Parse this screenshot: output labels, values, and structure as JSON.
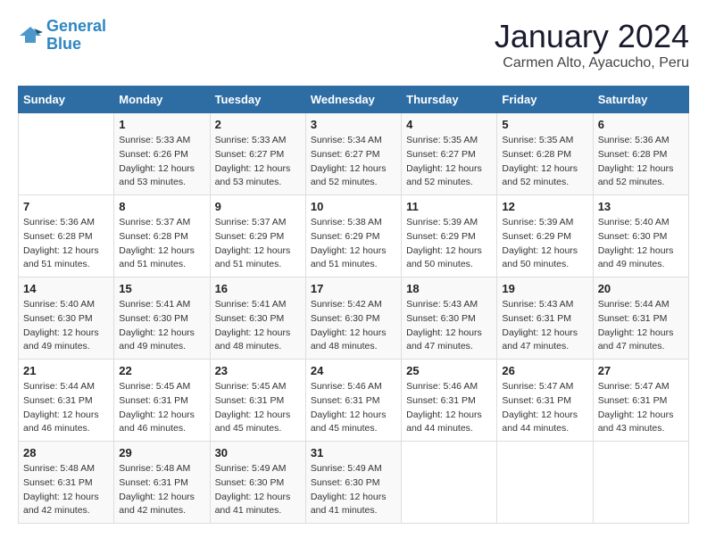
{
  "header": {
    "logo_line1": "General",
    "logo_line2": "Blue",
    "month": "January 2024",
    "location": "Carmen Alto, Ayacucho, Peru"
  },
  "days_of_week": [
    "Sunday",
    "Monday",
    "Tuesday",
    "Wednesday",
    "Thursday",
    "Friday",
    "Saturday"
  ],
  "weeks": [
    [
      {
        "day": "",
        "sunrise": "",
        "sunset": "",
        "daylight": ""
      },
      {
        "day": "1",
        "sunrise": "Sunrise: 5:33 AM",
        "sunset": "Sunset: 6:26 PM",
        "daylight": "Daylight: 12 hours and 53 minutes."
      },
      {
        "day": "2",
        "sunrise": "Sunrise: 5:33 AM",
        "sunset": "Sunset: 6:27 PM",
        "daylight": "Daylight: 12 hours and 53 minutes."
      },
      {
        "day": "3",
        "sunrise": "Sunrise: 5:34 AM",
        "sunset": "Sunset: 6:27 PM",
        "daylight": "Daylight: 12 hours and 52 minutes."
      },
      {
        "day": "4",
        "sunrise": "Sunrise: 5:35 AM",
        "sunset": "Sunset: 6:27 PM",
        "daylight": "Daylight: 12 hours and 52 minutes."
      },
      {
        "day": "5",
        "sunrise": "Sunrise: 5:35 AM",
        "sunset": "Sunset: 6:28 PM",
        "daylight": "Daylight: 12 hours and 52 minutes."
      },
      {
        "day": "6",
        "sunrise": "Sunrise: 5:36 AM",
        "sunset": "Sunset: 6:28 PM",
        "daylight": "Daylight: 12 hours and 52 minutes."
      }
    ],
    [
      {
        "day": "7",
        "sunrise": "Sunrise: 5:36 AM",
        "sunset": "Sunset: 6:28 PM",
        "daylight": "Daylight: 12 hours and 51 minutes."
      },
      {
        "day": "8",
        "sunrise": "Sunrise: 5:37 AM",
        "sunset": "Sunset: 6:28 PM",
        "daylight": "Daylight: 12 hours and 51 minutes."
      },
      {
        "day": "9",
        "sunrise": "Sunrise: 5:37 AM",
        "sunset": "Sunset: 6:29 PM",
        "daylight": "Daylight: 12 hours and 51 minutes."
      },
      {
        "day": "10",
        "sunrise": "Sunrise: 5:38 AM",
        "sunset": "Sunset: 6:29 PM",
        "daylight": "Daylight: 12 hours and 51 minutes."
      },
      {
        "day": "11",
        "sunrise": "Sunrise: 5:39 AM",
        "sunset": "Sunset: 6:29 PM",
        "daylight": "Daylight: 12 hours and 50 minutes."
      },
      {
        "day": "12",
        "sunrise": "Sunrise: 5:39 AM",
        "sunset": "Sunset: 6:29 PM",
        "daylight": "Daylight: 12 hours and 50 minutes."
      },
      {
        "day": "13",
        "sunrise": "Sunrise: 5:40 AM",
        "sunset": "Sunset: 6:30 PM",
        "daylight": "Daylight: 12 hours and 49 minutes."
      }
    ],
    [
      {
        "day": "14",
        "sunrise": "Sunrise: 5:40 AM",
        "sunset": "Sunset: 6:30 PM",
        "daylight": "Daylight: 12 hours and 49 minutes."
      },
      {
        "day": "15",
        "sunrise": "Sunrise: 5:41 AM",
        "sunset": "Sunset: 6:30 PM",
        "daylight": "Daylight: 12 hours and 49 minutes."
      },
      {
        "day": "16",
        "sunrise": "Sunrise: 5:41 AM",
        "sunset": "Sunset: 6:30 PM",
        "daylight": "Daylight: 12 hours and 48 minutes."
      },
      {
        "day": "17",
        "sunrise": "Sunrise: 5:42 AM",
        "sunset": "Sunset: 6:30 PM",
        "daylight": "Daylight: 12 hours and 48 minutes."
      },
      {
        "day": "18",
        "sunrise": "Sunrise: 5:43 AM",
        "sunset": "Sunset: 6:30 PM",
        "daylight": "Daylight: 12 hours and 47 minutes."
      },
      {
        "day": "19",
        "sunrise": "Sunrise: 5:43 AM",
        "sunset": "Sunset: 6:31 PM",
        "daylight": "Daylight: 12 hours and 47 minutes."
      },
      {
        "day": "20",
        "sunrise": "Sunrise: 5:44 AM",
        "sunset": "Sunset: 6:31 PM",
        "daylight": "Daylight: 12 hours and 47 minutes."
      }
    ],
    [
      {
        "day": "21",
        "sunrise": "Sunrise: 5:44 AM",
        "sunset": "Sunset: 6:31 PM",
        "daylight": "Daylight: 12 hours and 46 minutes."
      },
      {
        "day": "22",
        "sunrise": "Sunrise: 5:45 AM",
        "sunset": "Sunset: 6:31 PM",
        "daylight": "Daylight: 12 hours and 46 minutes."
      },
      {
        "day": "23",
        "sunrise": "Sunrise: 5:45 AM",
        "sunset": "Sunset: 6:31 PM",
        "daylight": "Daylight: 12 hours and 45 minutes."
      },
      {
        "day": "24",
        "sunrise": "Sunrise: 5:46 AM",
        "sunset": "Sunset: 6:31 PM",
        "daylight": "Daylight: 12 hours and 45 minutes."
      },
      {
        "day": "25",
        "sunrise": "Sunrise: 5:46 AM",
        "sunset": "Sunset: 6:31 PM",
        "daylight": "Daylight: 12 hours and 44 minutes."
      },
      {
        "day": "26",
        "sunrise": "Sunrise: 5:47 AM",
        "sunset": "Sunset: 6:31 PM",
        "daylight": "Daylight: 12 hours and 44 minutes."
      },
      {
        "day": "27",
        "sunrise": "Sunrise: 5:47 AM",
        "sunset": "Sunset: 6:31 PM",
        "daylight": "Daylight: 12 hours and 43 minutes."
      }
    ],
    [
      {
        "day": "28",
        "sunrise": "Sunrise: 5:48 AM",
        "sunset": "Sunset: 6:31 PM",
        "daylight": "Daylight: 12 hours and 42 minutes."
      },
      {
        "day": "29",
        "sunrise": "Sunrise: 5:48 AM",
        "sunset": "Sunset: 6:31 PM",
        "daylight": "Daylight: 12 hours and 42 minutes."
      },
      {
        "day": "30",
        "sunrise": "Sunrise: 5:49 AM",
        "sunset": "Sunset: 6:30 PM",
        "daylight": "Daylight: 12 hours and 41 minutes."
      },
      {
        "day": "31",
        "sunrise": "Sunrise: 5:49 AM",
        "sunset": "Sunset: 6:30 PM",
        "daylight": "Daylight: 12 hours and 41 minutes."
      },
      {
        "day": "",
        "sunrise": "",
        "sunset": "",
        "daylight": ""
      },
      {
        "day": "",
        "sunrise": "",
        "sunset": "",
        "daylight": ""
      },
      {
        "day": "",
        "sunrise": "",
        "sunset": "",
        "daylight": ""
      }
    ]
  ]
}
